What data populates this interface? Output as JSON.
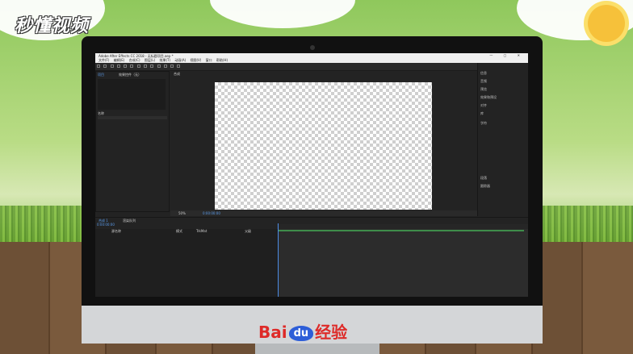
{
  "watermark": {
    "logo_text": "秒懂视频"
  },
  "footer": {
    "brand_bai": "Bai",
    "brand_du": "du",
    "brand_suffix": "经验"
  },
  "app": {
    "window_title": "Adobe After Effects CC 2018 - 无标题项目.aep *",
    "menu_items": [
      "文件(F)",
      "编辑(E)",
      "合成(C)",
      "图层(L)",
      "效果(T)",
      "动画(A)",
      "视图(V)",
      "窗口",
      "帮助(H)"
    ],
    "project_tab": "项目",
    "effects_tab": "效果控件（无）",
    "composition_tab": "合成",
    "timeline_tab": "合成 1",
    "render_tab": "渲染队列",
    "zoom_level": "50%",
    "timecode": "0:00:00:00",
    "right_panel_items": [
      "信息",
      "音频",
      "预览",
      "效果和预设",
      "对齐",
      "库",
      "字符",
      "段落",
      "跟踪器"
    ],
    "column_headers": [
      "源名称",
      "模式",
      "TrkMat",
      "父级"
    ],
    "layer_name_header": "名称"
  },
  "colors": {
    "accent_blue": "#2d5ed8",
    "brand_red": "#de2a28",
    "timeline_green": "#3e8d4a"
  }
}
